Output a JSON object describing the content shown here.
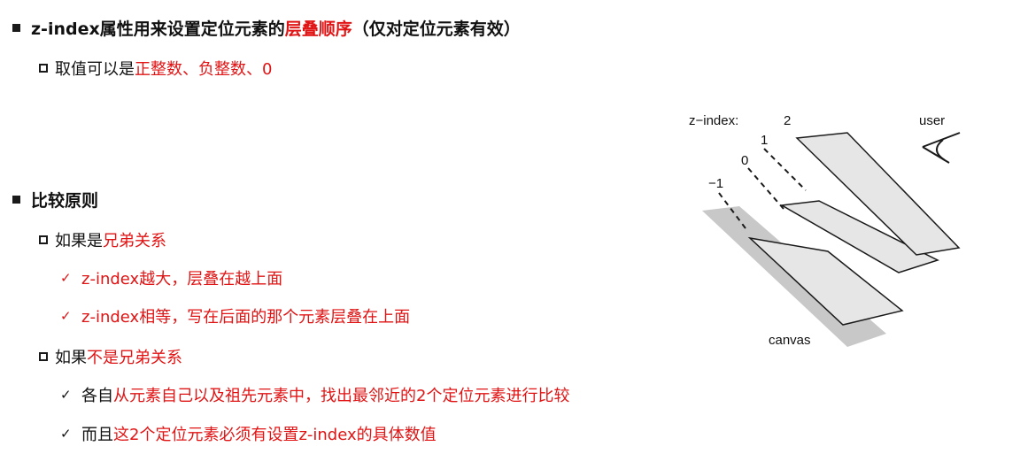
{
  "section1": {
    "heading_pre": "z-index属性用来设置定位元素的",
    "heading_red": "层叠顺序",
    "heading_post": "（仅对定位元素有效）",
    "item_pre": "取值可以是",
    "item_red": "正整数、负整数、0"
  },
  "section2": {
    "heading": "比较原则",
    "sub1": {
      "pre": "如果是",
      "red": "兄弟关系",
      "checks": [
        "z-index越大，层叠在越上面",
        "z-index相等，写在后面的那个元素层叠在上面"
      ]
    },
    "sub2": {
      "pre": "如果",
      "red": "不是兄弟关系",
      "check1_pre": "各自",
      "check1_red": "从元素自己以及祖先元素中，找出最邻近的2个定位元素进行比较",
      "check2_pre": "而且",
      "check2_red": "这2个定位元素必须有设置z-index的具体数值"
    }
  },
  "diagram": {
    "zindex_label": "z−index:",
    "levels": [
      "2",
      "1",
      "0",
      "−1"
    ],
    "user_label": "user",
    "canvas_label": "canvas"
  },
  "colors": {
    "accent": "#e01414",
    "text": "#111111"
  }
}
